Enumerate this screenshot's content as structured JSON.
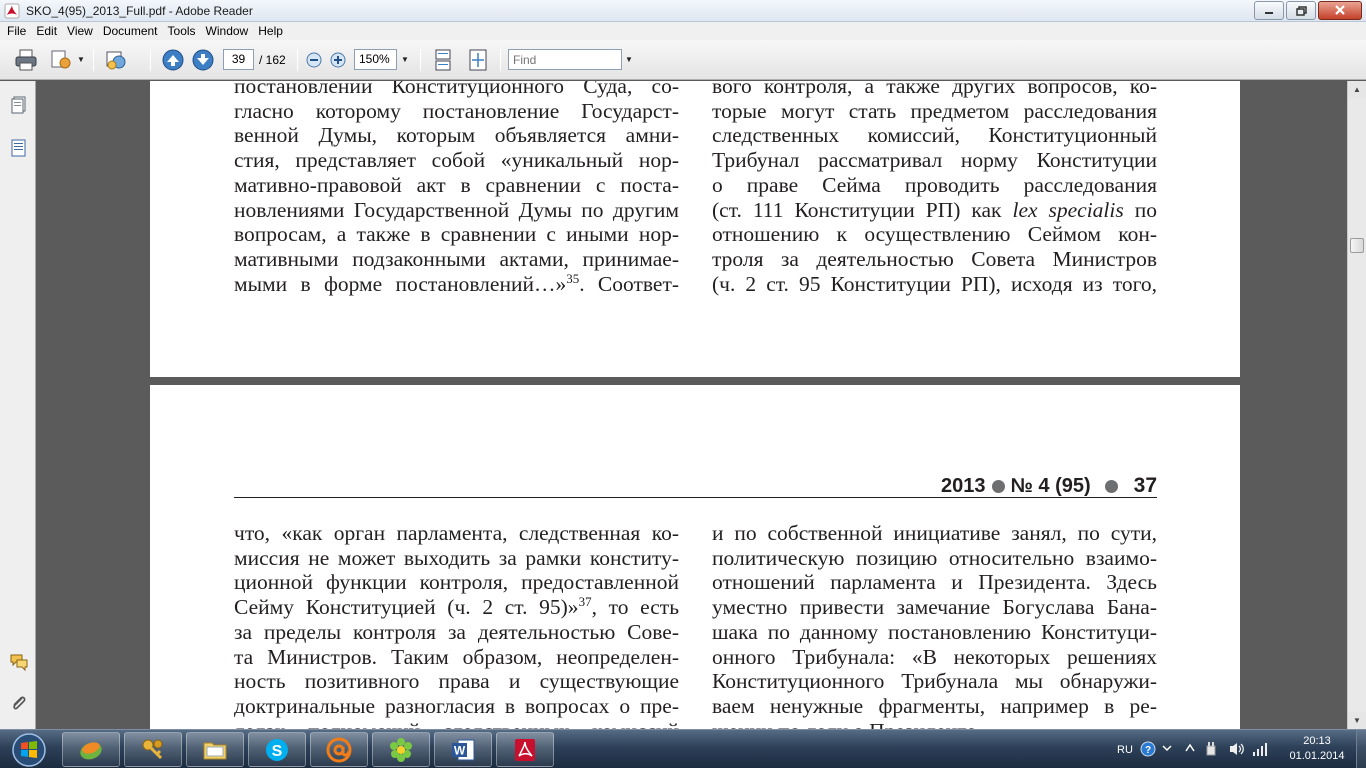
{
  "window": {
    "title": "SKO_4(95)_2013_Full.pdf - Adobe Reader"
  },
  "menu": {
    "items": [
      "File",
      "Edit",
      "View",
      "Document",
      "Tools",
      "Window",
      "Help"
    ]
  },
  "toolbar": {
    "page_number": "39",
    "page_total": "/ 162",
    "zoom": "150%",
    "find_placeholder": "Find"
  },
  "page_top": {
    "left_lines": [
      "постановлении Конституционного Суда, со-",
      "гласно которому постановление Государст-",
      "венной Думы, которым объявляется амни-",
      "стия, представляет собой «уникальный нор-",
      "мативно-правовой акт в сравнении с поста-",
      "новлениями Государственной Думы по другим",
      "вопросам, а также в сравнении с иными нор-",
      "мативными подзаконными актами, принимае-"
    ],
    "left_last_prefix": "мыми в форме постановлений…»",
    "left_last_sup": "35",
    "left_last_suffix": ". Соответ-",
    "right_lines": [
      "вого контроля, а также других вопросов, ко-",
      "торые могут стать предметом расследования",
      "следственных комиссий, Конституционный",
      "Трибунал рассматривал норму Конституции",
      "о праве Сейма проводить расследования"
    ],
    "right_line6_prefix": "(ст. 111 Конституции РП) как ",
    "right_line6_italic": "lex specialis",
    "right_line6_suffix": " по",
    "right_lines_b": [
      "отношению к осуществлению Сеймом кон-",
      "троля за деятельностью Совета Министров",
      "(ч. 2 ст. 95 Конституции РП), исходя из того,"
    ]
  },
  "page_bottom": {
    "running_head": {
      "year": "2013",
      "issue": "№ 4 (95)",
      "page": "37"
    },
    "left_lines_a": [
      "что, «как орган парламента, следственная ко-",
      "миссия не может выходить за рамки конститу-",
      "ционной функции контроля, предоставленной"
    ],
    "left_line4_prefix": "Сейму Конституцией (ч. 2 ст. 95)»",
    "left_line4_sup": "37",
    "left_line4_suffix": ", то есть",
    "left_lines_b": [
      "за пределы контроля за деятельностью Сове-",
      "та Министров. Таким образом, неопределен-",
      "ность позитивного права и существующие",
      "доктринальные разногласия в вопросах о пре-",
      "делах полномочий следственных комиссий"
    ],
    "right_lines": [
      "и по собственной инициативе занял, по сути,",
      "политическую позицию относительно взаимо-",
      "отношений парламента и Президента. Здесь",
      "уместно привести замечание Богуслава Бана-",
      "шака по данному постановлению Конституци-",
      "онного Трибунала: «В некоторых решениях",
      "Конституционного Трибунала мы обнаружи-",
      "ваем ненужные фрагменты, например в ре-",
      "шении по делу о Президенте"
    ]
  },
  "taskbar": {
    "apps": [
      "Uninstall tool",
      "System tools",
      "File manager",
      "Skype",
      "Mail",
      "ICQ",
      "Microsoft Word",
      "Adobe Reader"
    ],
    "language": "RU",
    "time": "20:13",
    "date": "01.01.2014"
  }
}
